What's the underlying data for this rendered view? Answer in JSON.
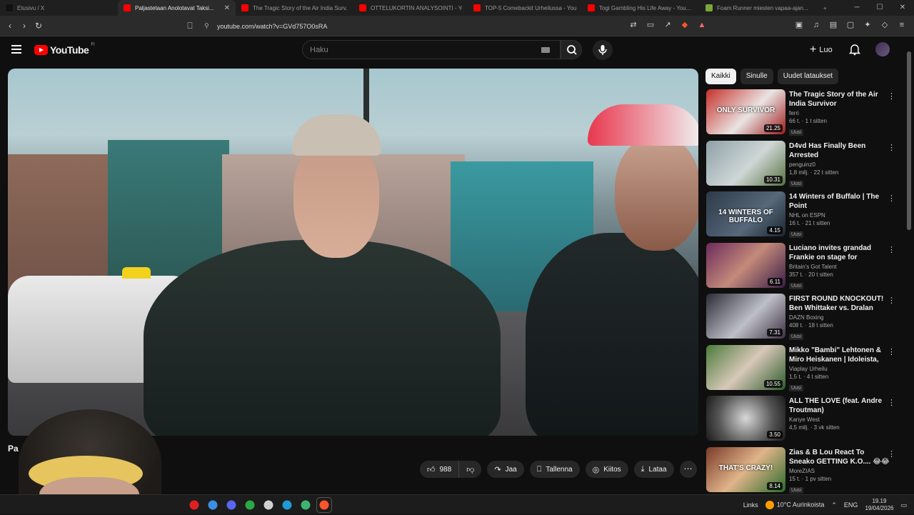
{
  "browser": {
    "tabs": [
      {
        "title": "Etusivu / X",
        "color": "#111111"
      },
      {
        "title": "Paljastetaan Anolotavat Taksi...",
        "color": "#ff0000",
        "active": true
      },
      {
        "title": "The Tragic Story of the Air India Surv...",
        "color": "#ff0000"
      },
      {
        "title": "OTTELUKORTIN ANALYSOINTI - You...",
        "color": "#ff0000"
      },
      {
        "title": "TOP-5 Comebackit Urheilussa - You...",
        "color": "#ff0000"
      },
      {
        "title": "Togi Gambling His Life Away - You...",
        "color": "#ff0000"
      },
      {
        "title": "Foam Runner miesten vapaa-ajan...",
        "color": "#7aa63a"
      }
    ],
    "tab_close": "✕",
    "new_tab": "+",
    "window_controls": [
      "─",
      "☐",
      "✕"
    ],
    "url": "youtube.com/watch?v=GVd757O0sRA"
  },
  "header": {
    "logo_text": "YouTube",
    "country_code": "FI",
    "search_placeholder": "Haku",
    "create_label": "Luo"
  },
  "video": {
    "title_partial": "Pa"
  },
  "actions": {
    "likes": "988",
    "share": "Jaa",
    "save": "Tallenna",
    "thanks": "Kiitos",
    "download": "Lataa",
    "more": "⋯"
  },
  "filters": [
    "Kaikki",
    "Sinulle",
    "Uudet lataukset"
  ],
  "recommendations": [
    {
      "title": "The Tragic Story of the Air India Survivor",
      "channel": "ferri",
      "meta": "66 t. · 1 t sitten",
      "duration": "21.25",
      "badge": "Uusi",
      "thumb": "linear-gradient(135deg,#c7302a,#e9e4e3 55%,#9c1a1a)",
      "overlay": "ONLY SURVIVOR"
    },
    {
      "title": "D4vd Has Finally Been Arrested",
      "channel": "penguinz0",
      "meta": "1,8 milj. · 22 t sitten",
      "duration": "10.31",
      "badge": "Uusi",
      "thumb": "linear-gradient(135deg,#8ea0a8,#cfd7d6 55%,#56703f)",
      "overlay": ""
    },
    {
      "title": "14 Winters of Buffalo | The Point",
      "channel": "NHL on ESPN",
      "meta": "16 t. · 21 t sitten",
      "duration": "4.15",
      "badge": "Uusi",
      "thumb": "linear-gradient(135deg,#2d3a48,#56687a 60%,#1c2530)",
      "overlay": "14 WINTERS OF BUFFALO"
    },
    {
      "title": "Luciano invites grandad Frankie on stage for emotiona...",
      "channel": "Britain's Got Talent",
      "meta": "357 t. · 20 t sitten",
      "duration": "6.11",
      "badge": "Uusi",
      "thumb": "linear-gradient(135deg,#6b2a5b,#c48a7a 50%,#3a1d46)",
      "overlay": ""
    },
    {
      "title": "FIRST ROUND KNOCKOUT! Ben Whittaker vs. Dralan Suarez | ...",
      "channel": "DAZN Boxing",
      "meta": "408 t. · 18 t sitten",
      "duration": "7.31",
      "badge": "Uusi",
      "thumb": "linear-gradient(135deg,#2b2b35,#bfbfc9 55%,#3b3040)",
      "overlay": ""
    },
    {
      "title": "Mikko \"Bambi\" Lehtonen & Miro Heiskanen | Idoleista, urasta &...",
      "channel": "Viaplay Urheilu",
      "meta": "1,5 t. · 4 t sitten",
      "duration": "10.55",
      "badge": "Uusi",
      "thumb": "linear-gradient(135deg,#4a7a3a,#d8c8b8 50%,#2c5a2a)",
      "overlay": ""
    },
    {
      "title": "ALL THE LOVE (feat. Andre Troutman)",
      "channel": "Kanye West",
      "meta": "4,5 milj. · 3 vk sitten",
      "duration": "3.50",
      "badge": "",
      "thumb": "radial-gradient(circle at 50% 50%,#d8d8d8,#555 60%,#1a1a1a)",
      "overlay": ""
    },
    {
      "title": "Zias & B Lou React To Sneako GETTING K.O.... 😂😂",
      "channel": "MoreZIAS",
      "meta": "15 t. · 1 pv sitten",
      "duration": "8.14",
      "badge": "Uusi",
      "thumb": "linear-gradient(135deg,#7a3a28,#e0b48a 50%,#2a6a2a)",
      "overlay": "THAT'S CRAZY!"
    }
  ],
  "taskbar": {
    "links_label": "Links",
    "weather": "10°C Aurinkoista",
    "language": "ENG",
    "time": "19.19",
    "date": "19/04/2026",
    "apps": [
      "#e02020",
      "#3a8ee6",
      "#5865f2",
      "#2aa845",
      "#d0d0d0",
      "#1f9ad6",
      "#3cb371",
      "#fb542b"
    ]
  },
  "colors": {
    "youtube_red": "#ff0000",
    "bg": "#0f0f0f",
    "chip": "#272727"
  }
}
